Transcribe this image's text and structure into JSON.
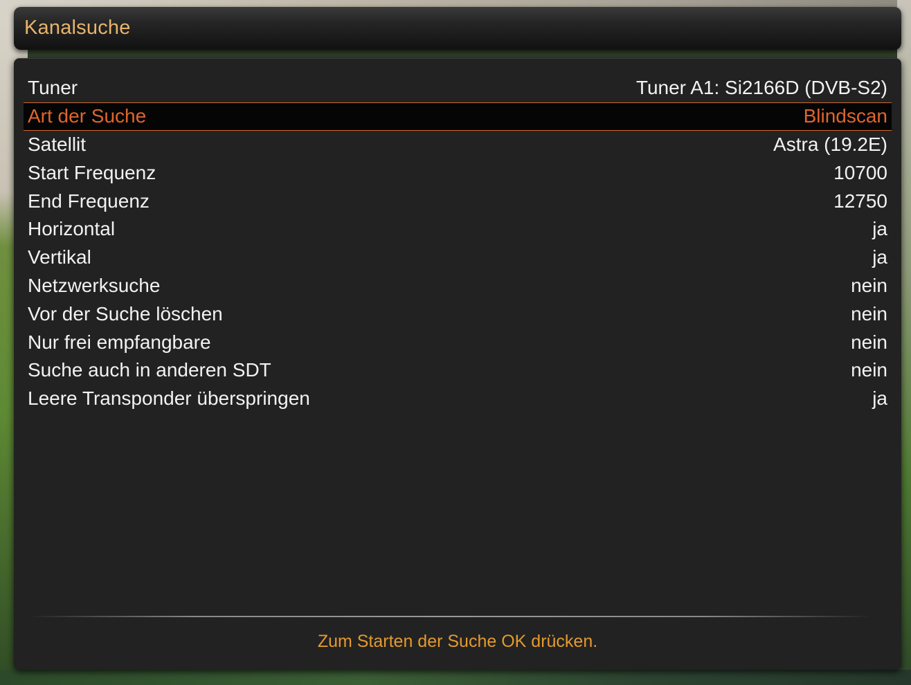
{
  "window": {
    "title": "Kanalsuche"
  },
  "settings": [
    {
      "label": "Tuner",
      "value": "Tuner A1: Si2166D (DVB-S2)",
      "selected": false
    },
    {
      "label": "Art der Suche",
      "value": "Blindscan",
      "selected": true
    },
    {
      "label": "Satellit",
      "value": "Astra (19.2E)",
      "selected": false
    },
    {
      "label": "Start Frequenz",
      "value": "10700",
      "selected": false
    },
    {
      "label": "End Frequenz",
      "value": "12750",
      "selected": false
    },
    {
      "label": "Horizontal",
      "value": "ja",
      "selected": false
    },
    {
      "label": "Vertikal",
      "value": "ja",
      "selected": false
    },
    {
      "label": "Netzwerksuche",
      "value": "nein",
      "selected": false
    },
    {
      "label": "Vor der Suche löschen",
      "value": "nein",
      "selected": false
    },
    {
      "label": "Nur frei empfangbare",
      "value": "nein",
      "selected": false
    },
    {
      "label": "Suche auch in anderen SDT",
      "value": "nein",
      "selected": false
    },
    {
      "label": "Leere Transponder überspringen",
      "value": "ja",
      "selected": false
    }
  ],
  "footer": {
    "hint": "Zum Starten der Suche OK drücken."
  },
  "colors": {
    "title": "#e8b46b",
    "selection": "#e0652b",
    "hint": "#e59a2e",
    "panel_bg": "#222222"
  }
}
